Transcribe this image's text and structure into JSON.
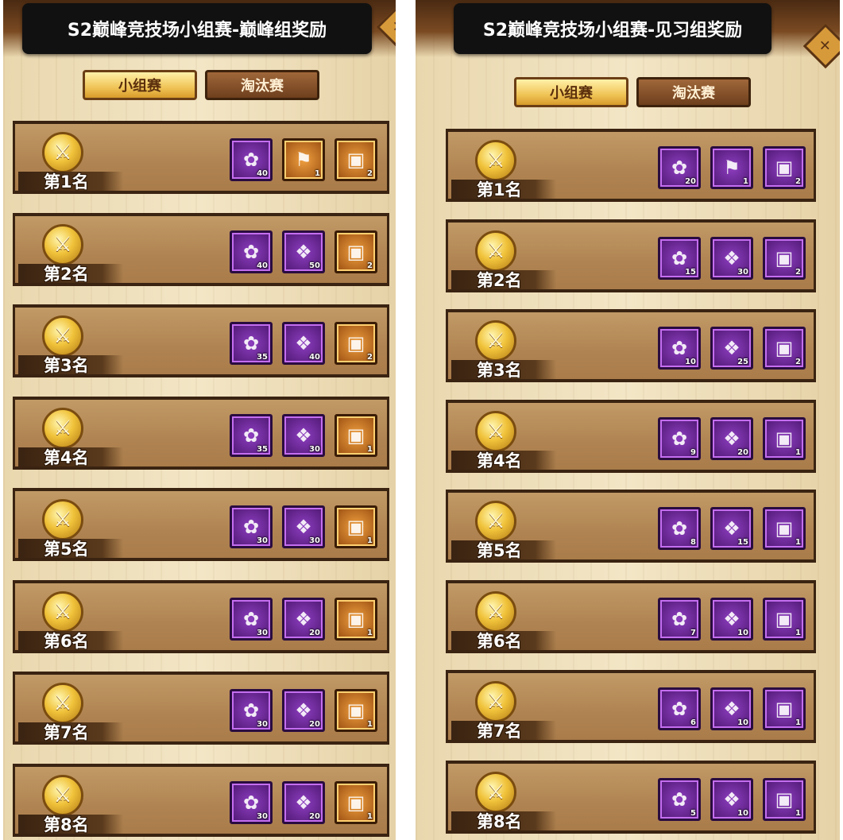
{
  "panels": [
    {
      "title": "S2巅峰竞技场小组赛-巅峰组奖励",
      "tabs": [
        "小组赛",
        "淘汰赛"
      ],
      "active_tab": "小组赛",
      "rows": [
        {
          "rank": "第1名",
          "items": [
            {
              "icon": "token-bag-icon",
              "count": "40"
            },
            {
              "icon": "banner-frame-icon",
              "count": "1"
            },
            {
              "icon": "treasure-chest-icon",
              "count": "2"
            }
          ]
        },
        {
          "rank": "第2名",
          "items": [
            {
              "icon": "token-bag-icon",
              "count": "40"
            },
            {
              "icon": "stamp-card-icon",
              "count": "50"
            },
            {
              "icon": "treasure-chest-icon",
              "count": "2"
            }
          ]
        },
        {
          "rank": "第3名",
          "items": [
            {
              "icon": "token-bag-icon",
              "count": "35"
            },
            {
              "icon": "stamp-card-icon",
              "count": "40"
            },
            {
              "icon": "treasure-chest-icon",
              "count": "2"
            }
          ]
        },
        {
          "rank": "第4名",
          "items": [
            {
              "icon": "token-bag-icon",
              "count": "35"
            },
            {
              "icon": "stamp-card-icon",
              "count": "30"
            },
            {
              "icon": "treasure-chest-icon",
              "count": "1"
            }
          ]
        },
        {
          "rank": "第5名",
          "items": [
            {
              "icon": "token-bag-icon",
              "count": "30"
            },
            {
              "icon": "stamp-card-icon",
              "count": "30"
            },
            {
              "icon": "treasure-chest-icon",
              "count": "1"
            }
          ]
        },
        {
          "rank": "第6名",
          "items": [
            {
              "icon": "token-bag-icon",
              "count": "30"
            },
            {
              "icon": "stamp-card-icon",
              "count": "20"
            },
            {
              "icon": "treasure-chest-icon",
              "count": "1"
            }
          ]
        },
        {
          "rank": "第7名",
          "items": [
            {
              "icon": "token-bag-icon",
              "count": "30"
            },
            {
              "icon": "stamp-card-icon",
              "count": "20"
            },
            {
              "icon": "treasure-chest-icon",
              "count": "1"
            }
          ]
        },
        {
          "rank": "第8名",
          "items": [
            {
              "icon": "token-bag-icon",
              "count": "30"
            },
            {
              "icon": "stamp-card-icon",
              "count": "20"
            },
            {
              "icon": "treasure-chest-icon",
              "count": "1"
            }
          ]
        }
      ]
    },
    {
      "title": "S2巅峰竞技场小组赛-见习组奖励",
      "tabs": [
        "小组赛",
        "淘汰赛"
      ],
      "active_tab": "小组赛",
      "rows": [
        {
          "rank": "第1名",
          "items": [
            {
              "icon": "token-bag-icon",
              "count": "20"
            },
            {
              "icon": "banner-frame-icon",
              "count": "1"
            },
            {
              "icon": "treasure-chest-icon",
              "count": "2"
            }
          ]
        },
        {
          "rank": "第2名",
          "items": [
            {
              "icon": "token-bag-icon",
              "count": "15"
            },
            {
              "icon": "stamp-card-icon",
              "count": "30"
            },
            {
              "icon": "treasure-chest-icon",
              "count": "2"
            }
          ]
        },
        {
          "rank": "第3名",
          "items": [
            {
              "icon": "token-bag-icon",
              "count": "10"
            },
            {
              "icon": "stamp-card-icon",
              "count": "25"
            },
            {
              "icon": "treasure-chest-icon",
              "count": "2"
            }
          ]
        },
        {
          "rank": "第4名",
          "items": [
            {
              "icon": "token-bag-icon",
              "count": "9"
            },
            {
              "icon": "stamp-card-icon",
              "count": "20"
            },
            {
              "icon": "treasure-chest-icon",
              "count": "1"
            }
          ]
        },
        {
          "rank": "第5名",
          "items": [
            {
              "icon": "token-bag-icon",
              "count": "8"
            },
            {
              "icon": "stamp-card-icon",
              "count": "15"
            },
            {
              "icon": "treasure-chest-icon",
              "count": "1"
            }
          ]
        },
        {
          "rank": "第6名",
          "items": [
            {
              "icon": "token-bag-icon",
              "count": "7"
            },
            {
              "icon": "stamp-card-icon",
              "count": "10"
            },
            {
              "icon": "treasure-chest-icon",
              "count": "1"
            }
          ]
        },
        {
          "rank": "第7名",
          "items": [
            {
              "icon": "token-bag-icon",
              "count": "6"
            },
            {
              "icon": "stamp-card-icon",
              "count": "10"
            },
            {
              "icon": "treasure-chest-icon",
              "count": "1"
            }
          ]
        },
        {
          "rank": "第8名",
          "items": [
            {
              "icon": "token-bag-icon",
              "count": "5"
            },
            {
              "icon": "stamp-card-icon",
              "count": "10"
            },
            {
              "icon": "treasure-chest-icon",
              "count": "1"
            }
          ]
        }
      ]
    }
  ]
}
